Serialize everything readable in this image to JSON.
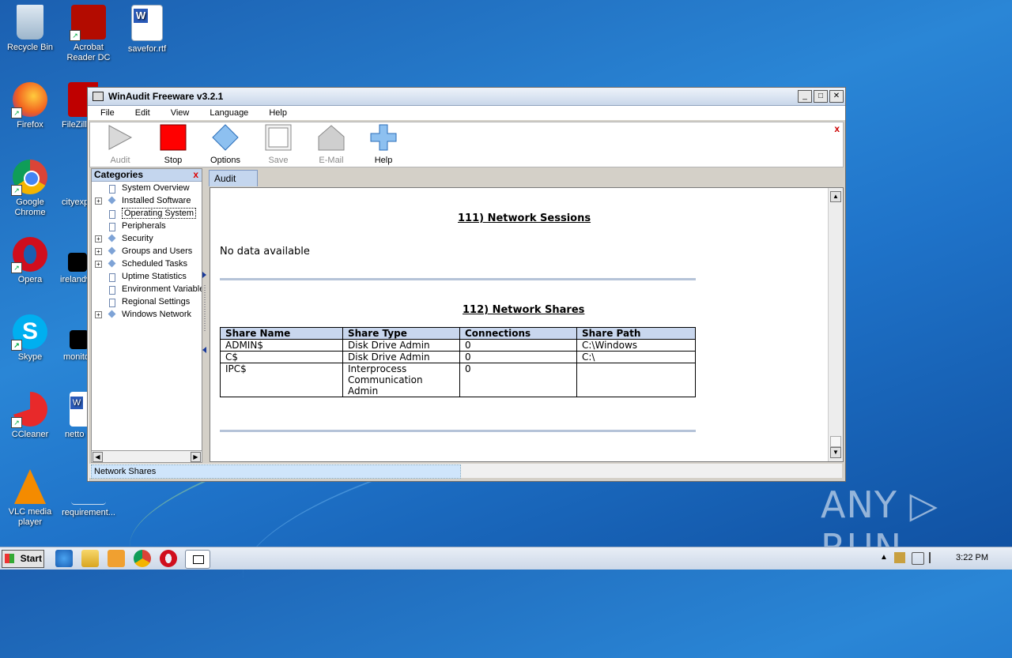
{
  "desktop": {
    "icons": [
      {
        "label": "Recycle Bin"
      },
      {
        "label": "Acrobat Reader DC"
      },
      {
        "label": "savefor.rtf"
      },
      {
        "label": "Firefox"
      },
      {
        "label": "FileZilla"
      },
      {
        "label": "Google Chrome"
      },
      {
        "label": "cityexp"
      },
      {
        "label": "Opera"
      },
      {
        "label": "irelandv"
      },
      {
        "label": "Skype"
      },
      {
        "label": "monito"
      },
      {
        "label": "CCleaner"
      },
      {
        "label": "netto"
      },
      {
        "label": "VLC media player"
      },
      {
        "label": "requirement..."
      }
    ],
    "watermark": "ANY ▷ RUN"
  },
  "window": {
    "title": "WinAudit Freeware v3.2.1",
    "controls": {
      "minimize": "_",
      "maximize": "□",
      "close": "✕"
    },
    "menu": [
      "File",
      "Edit",
      "View",
      "Language",
      "Help"
    ],
    "toolbar": {
      "close": "x",
      "buttons": [
        {
          "label": "Audit",
          "icon": "play-icon",
          "enabled": false
        },
        {
          "label": "Stop",
          "icon": "stop-icon",
          "enabled": true
        },
        {
          "label": "Options",
          "icon": "options-icon",
          "enabled": true
        },
        {
          "label": "Save",
          "icon": "save-icon",
          "enabled": false
        },
        {
          "label": "E-Mail",
          "icon": "email-icon",
          "enabled": false
        },
        {
          "label": "Help",
          "icon": "help-icon",
          "enabled": true
        }
      ]
    },
    "categories": {
      "title": "Categories",
      "close": "x",
      "items": [
        {
          "label": "System Overview",
          "expandable": false,
          "icon": "doc"
        },
        {
          "label": "Installed Software",
          "expandable": true,
          "icon": "diamond"
        },
        {
          "label": "Operating System",
          "expandable": false,
          "icon": "doc",
          "selected": true
        },
        {
          "label": "Peripherals",
          "expandable": false,
          "icon": "doc"
        },
        {
          "label": "Security",
          "expandable": true,
          "icon": "diamond"
        },
        {
          "label": "Groups and Users",
          "expandable": true,
          "icon": "diamond"
        },
        {
          "label": "Scheduled Tasks",
          "expandable": true,
          "icon": "diamond"
        },
        {
          "label": "Uptime Statistics",
          "expandable": false,
          "icon": "doc"
        },
        {
          "label": "Environment Variables",
          "expandable": false,
          "icon": "doc"
        },
        {
          "label": "Regional Settings",
          "expandable": false,
          "icon": "doc"
        },
        {
          "label": "Windows Network",
          "expandable": true,
          "icon": "diamond"
        }
      ]
    },
    "tabs": [
      {
        "label": "Audit"
      }
    ],
    "report": {
      "section1_title": "111) Network Sessions",
      "section1_text": "No data available",
      "section2_title": "112) Network Shares",
      "table": {
        "columns": [
          "Share Name",
          "Share Type",
          "Connections",
          "Share Path"
        ],
        "rows": [
          [
            "ADMIN$",
            "Disk Drive Admin",
            "0",
            "C:\\Windows"
          ],
          [
            "C$",
            "Disk Drive Admin",
            "0",
            "C:\\"
          ],
          [
            "IPC$",
            "Interprocess Communication Admin",
            "0",
            ""
          ]
        ]
      }
    },
    "status": "Network Shares"
  },
  "taskbar": {
    "start": "Start",
    "clock": "3:22 PM"
  }
}
